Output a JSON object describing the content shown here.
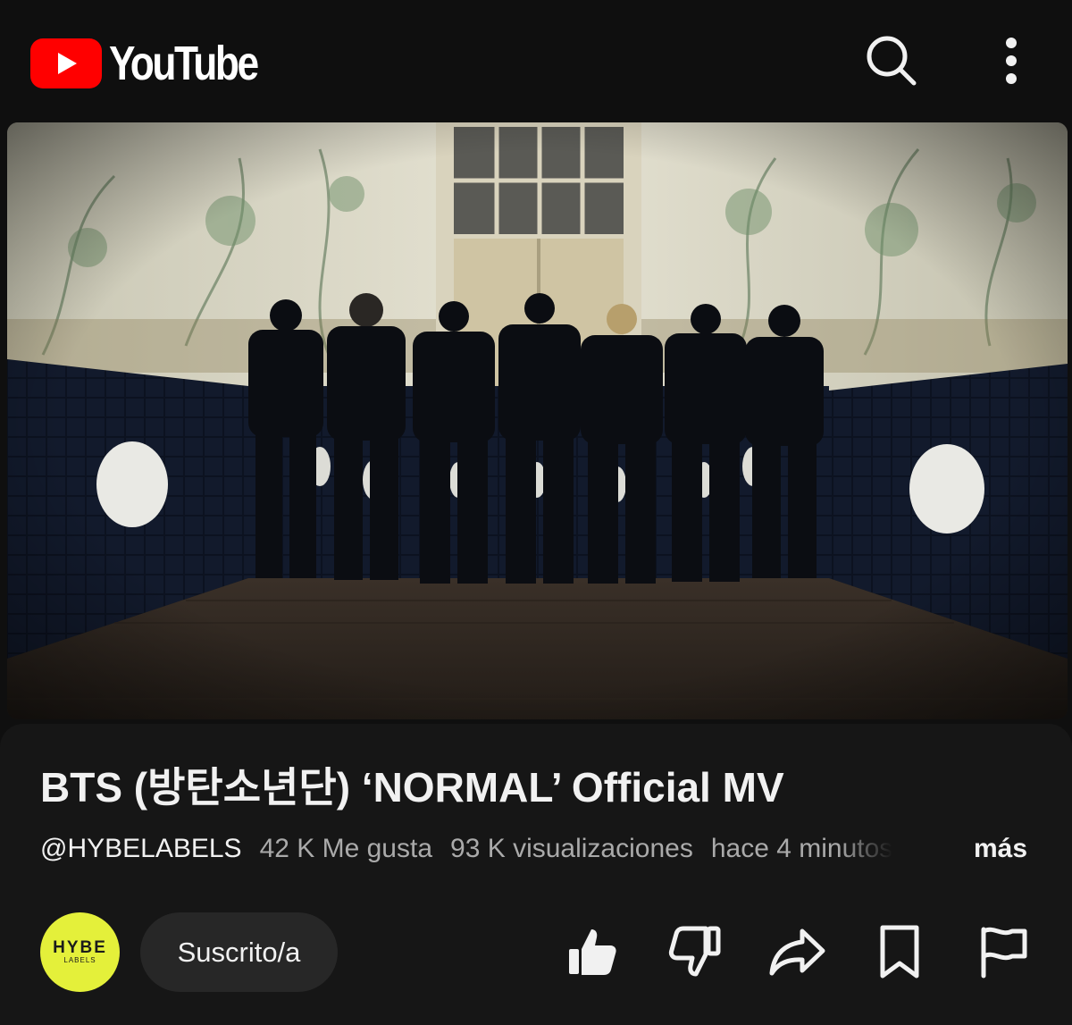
{
  "header": {
    "logo_text": "YouTube",
    "search_icon": "search-icon",
    "menu_icon": "more-vertical-icon",
    "brand_color": "#ff0000"
  },
  "video": {
    "title": "BTS (방탄소년단) ‘NORMAL’ Official MV",
    "channel_handle": "@HYBELABELS",
    "likes_text": "42 K Me gusta",
    "views_text": "93 K visualizaciones",
    "time_text": "hace 4 minutos",
    "more_label": "más"
  },
  "channel": {
    "avatar_line1": "HYBE",
    "avatar_line2": "LABELS",
    "avatar_color": "#e4f03a",
    "subscribe_label": "Suscrito/a"
  },
  "actions": [
    {
      "name": "like",
      "icon": "thumbs-up-filled-icon"
    },
    {
      "name": "dislike",
      "icon": "thumbs-down-icon"
    },
    {
      "name": "share",
      "icon": "share-arrow-icon"
    },
    {
      "name": "save",
      "icon": "bookmark-icon"
    },
    {
      "name": "report",
      "icon": "flag-icon"
    }
  ]
}
